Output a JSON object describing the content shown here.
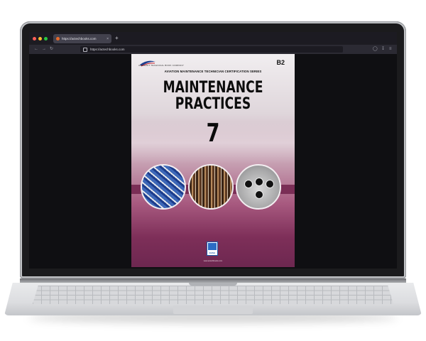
{
  "browser": {
    "tab": {
      "title": "https://actechbooks.com",
      "close_glyph": "×"
    },
    "new_tab_glyph": "+",
    "url": "https://actechbooks.com",
    "nav_icons": [
      "back-icon",
      "forward-icon",
      "reload-icon",
      "shield-icon",
      "download-icon",
      "menu-icon"
    ],
    "window_controls": [
      "#fe5f57",
      "#febc2e",
      "#28c840"
    ]
  },
  "book": {
    "publisher_logo_text": "AIRCRAFT TECHNICAL BOOK COMPANY",
    "module_code": "B2",
    "series": "AVIATION MAINTENANCE TECHNICIAN CERTIFICATION SERIES",
    "title_line1": "MAINTENANCE",
    "title_line2": "PRACTICES",
    "module_number": "7",
    "badge": "EASA",
    "footer_site": "www.actechbooks.com",
    "accent_color": "#7a2e56"
  }
}
